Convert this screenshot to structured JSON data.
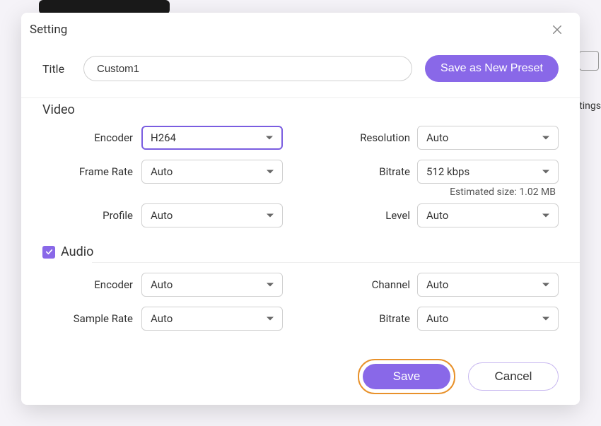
{
  "modal_title": "Setting",
  "title_label": "Title",
  "title_value": "Custom1",
  "save_preset_label": "Save as New Preset",
  "video": {
    "section": "Video",
    "encoder_label": "Encoder",
    "encoder_value": "H264",
    "resolution_label": "Resolution",
    "resolution_value": "Auto",
    "frame_rate_label": "Frame Rate",
    "frame_rate_value": "Auto",
    "bitrate_label": "Bitrate",
    "bitrate_value": "512 kbps",
    "estimated_label": "Estimated size: 1.02 MB",
    "profile_label": "Profile",
    "profile_value": "Auto",
    "level_label": "Level",
    "level_value": "Auto"
  },
  "audio": {
    "section": "Audio",
    "checked": true,
    "encoder_label": "Encoder",
    "encoder_value": "Auto",
    "channel_label": "Channel",
    "channel_value": "Auto",
    "sample_rate_label": "Sample Rate",
    "sample_rate_value": "Auto",
    "bitrate_label": "Bitrate",
    "bitrate_value": "Auto"
  },
  "footer": {
    "save": "Save",
    "cancel": "Cancel"
  },
  "bg_text": "ttings"
}
